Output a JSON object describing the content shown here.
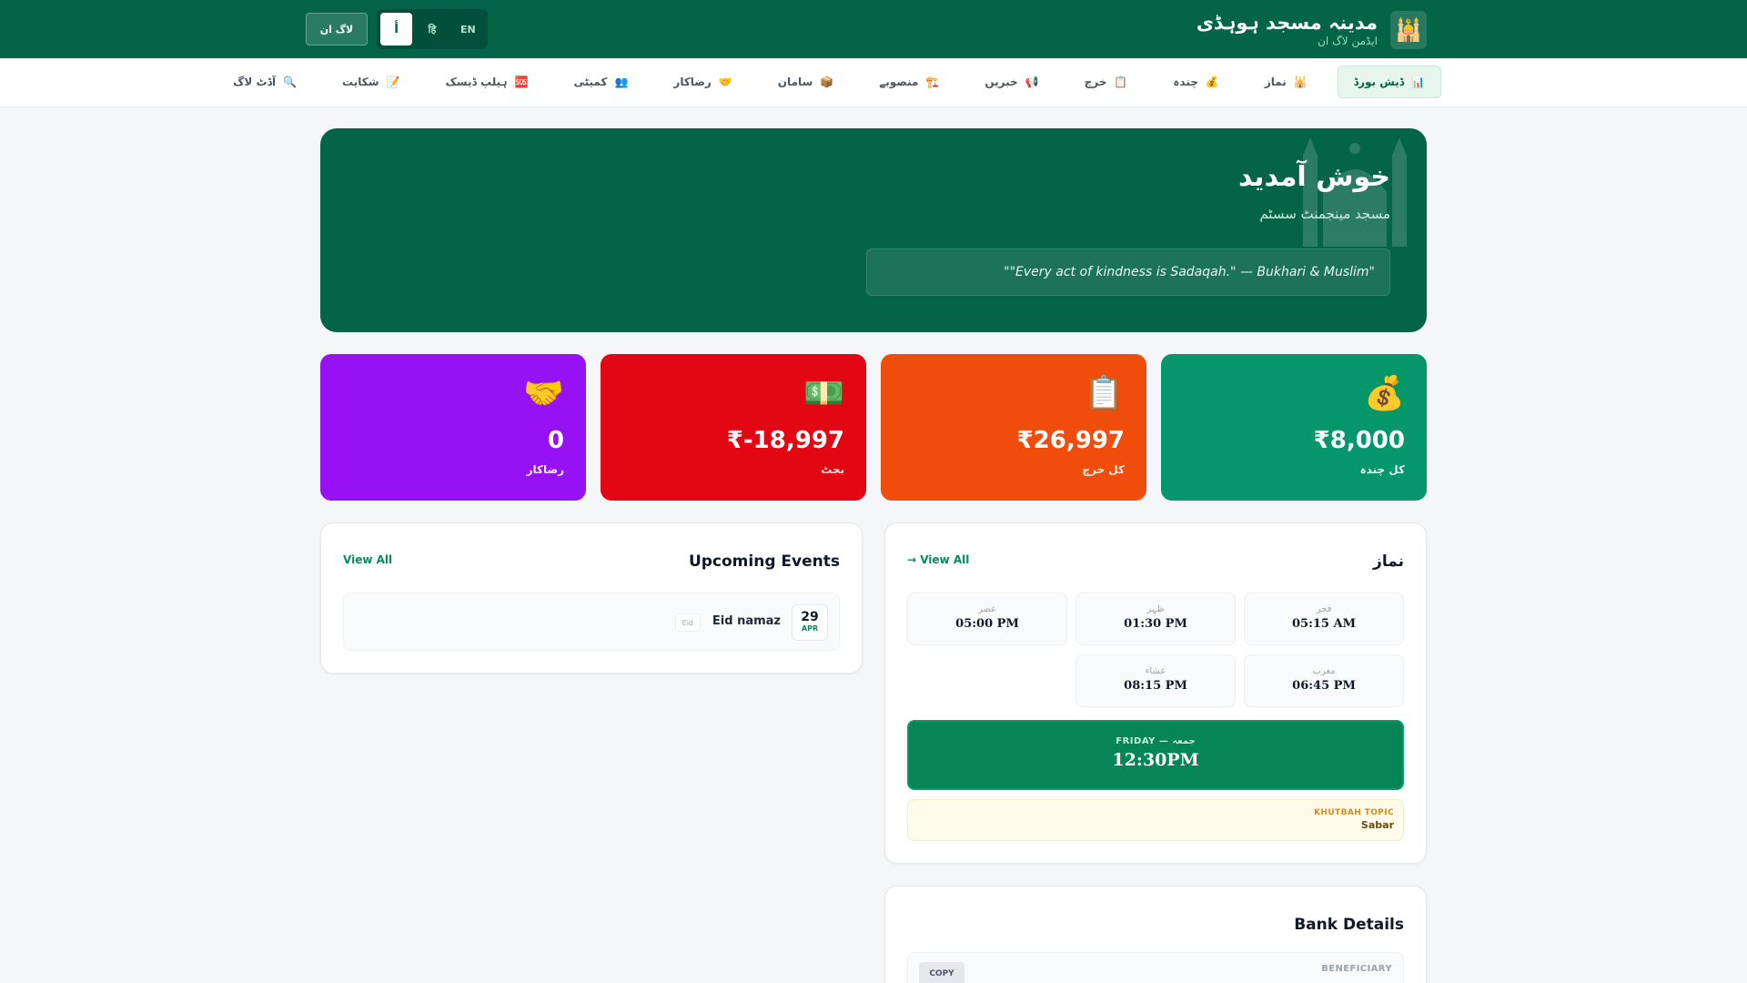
{
  "header": {
    "title": "مدینہ مسجد ہوہڈی",
    "subtitle": "ایڈمن لاگ ان",
    "logo_icon": "mosque-icon",
    "login_label": "لاگ ان",
    "languages": [
      {
        "label": "أ",
        "active": true
      },
      {
        "label": "हि",
        "active": false
      },
      {
        "label": "EN",
        "active": false
      }
    ]
  },
  "nav": {
    "items": [
      {
        "icon": "📊",
        "label": "ڈیش بورڈ",
        "active": true
      },
      {
        "icon": "🕌",
        "label": "نماز"
      },
      {
        "icon": "💰",
        "label": "چندہ"
      },
      {
        "icon": "📋",
        "label": "خرچ"
      },
      {
        "icon": "📢",
        "label": "خبریں"
      },
      {
        "icon": "🏗️",
        "label": "منصوبے"
      },
      {
        "icon": "📦",
        "label": "سامان"
      },
      {
        "icon": "🤝",
        "label": "رضاکار"
      },
      {
        "icon": "👥",
        "label": "کمیٹی"
      },
      {
        "icon": "🆘",
        "label": "ہیلپ ڈیسک"
      },
      {
        "icon": "📝",
        "label": "شکایت"
      },
      {
        "icon": "🔍",
        "label": "آڈٹ لاگ"
      }
    ]
  },
  "hero": {
    "title": "خوش آمدید",
    "subtitle": "مسجد مینجمنٹ سسٹم",
    "quote": "\"\"Every act of kindness is Sadaqah.\" — Bukhari & Muslim\""
  },
  "stats": [
    {
      "icon": "💰",
      "value": "₹8,000",
      "label": "کل چندہ",
      "color": "#059669"
    },
    {
      "icon": "📋",
      "value": "₹26,997",
      "label": "کل خرچ",
      "color": "#f04c0c"
    },
    {
      "icon": "💵",
      "value": "₹-18,997",
      "label": "بجٹ",
      "color": "#e30613"
    },
    {
      "icon": "🤝",
      "value": "0",
      "label": "رضاکار",
      "color": "#9612f5"
    }
  ],
  "prayer": {
    "title": "نماز",
    "view_all": "→ View All",
    "times": [
      {
        "name": "فجر",
        "time": "05:15 AM"
      },
      {
        "name": "ظہر",
        "time": "01:30 PM"
      },
      {
        "name": "عصر",
        "time": "05:00 PM"
      },
      {
        "name": "مغرب",
        "time": "06:45 PM"
      },
      {
        "name": "عشاء",
        "time": "08:15 PM"
      }
    ],
    "friday_label": "FRIDAY — جمعہ",
    "friday_time": "12:30PM",
    "khutbah_label": "KHUTBAH TOPIC",
    "khutbah_value": "Sabar"
  },
  "events": {
    "title": "Upcoming Events",
    "view_all": "View All",
    "items": [
      {
        "day": "29",
        "month": "APR",
        "name": "Eid namaz",
        "tag": "Eid"
      }
    ]
  },
  "bank": {
    "title": "Bank Details",
    "beneficiary_label": "BENEFICIARY",
    "copy_label": "COPY"
  }
}
